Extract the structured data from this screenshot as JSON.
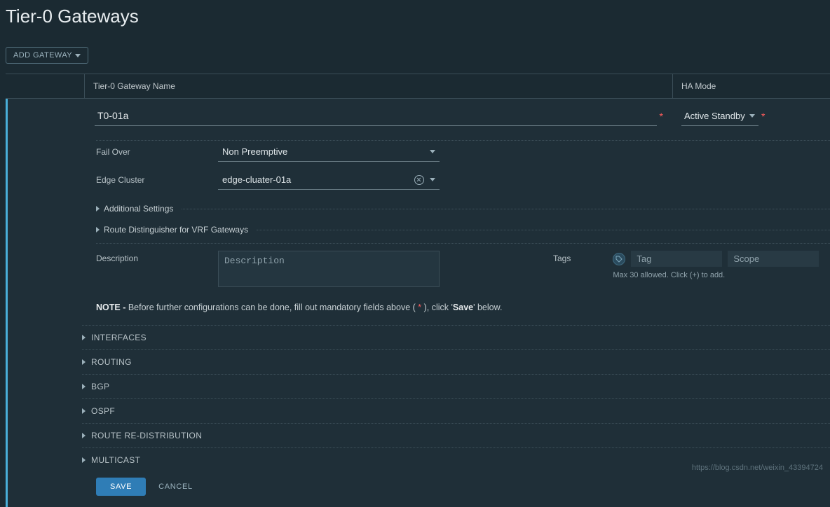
{
  "page": {
    "title": "Tier-0 Gateways",
    "add_button": "ADD GATEWAY"
  },
  "columns": {
    "name": "Tier-0 Gateway Name",
    "ha": "HA Mode"
  },
  "form": {
    "name_value": "T0-01a",
    "ha_value": "Active Standby",
    "failover_label": "Fail Over",
    "failover_value": "Non Preemptive",
    "edge_cluster_label": "Edge Cluster",
    "edge_cluster_value": "edge-cluater-01a",
    "additional_settings_label": "Additional Settings",
    "rd_vrf_label": "Route Distinguisher for VRF Gateways",
    "description_label": "Description",
    "description_placeholder": "Description",
    "tags_label": "Tags",
    "tag_placeholder": "Tag",
    "scope_placeholder": "Scope",
    "tag_hint": "Max 30 allowed. Click (+) to add."
  },
  "note": {
    "prefix_bold": "NOTE -",
    "text_before": " Before further configurations can be done, fill out mandatory fields above ( ",
    "star": "*",
    "text_mid": " ), click '",
    "save_bold": "Save",
    "text_after": "' below."
  },
  "sections": [
    "INTERFACES",
    "ROUTING",
    "BGP",
    "OSPF",
    "ROUTE RE-DISTRIBUTION",
    "MULTICAST"
  ],
  "actions": {
    "save": "SAVE",
    "cancel": "CANCEL"
  },
  "watermark": "https://blog.csdn.net/weixin_43394724"
}
